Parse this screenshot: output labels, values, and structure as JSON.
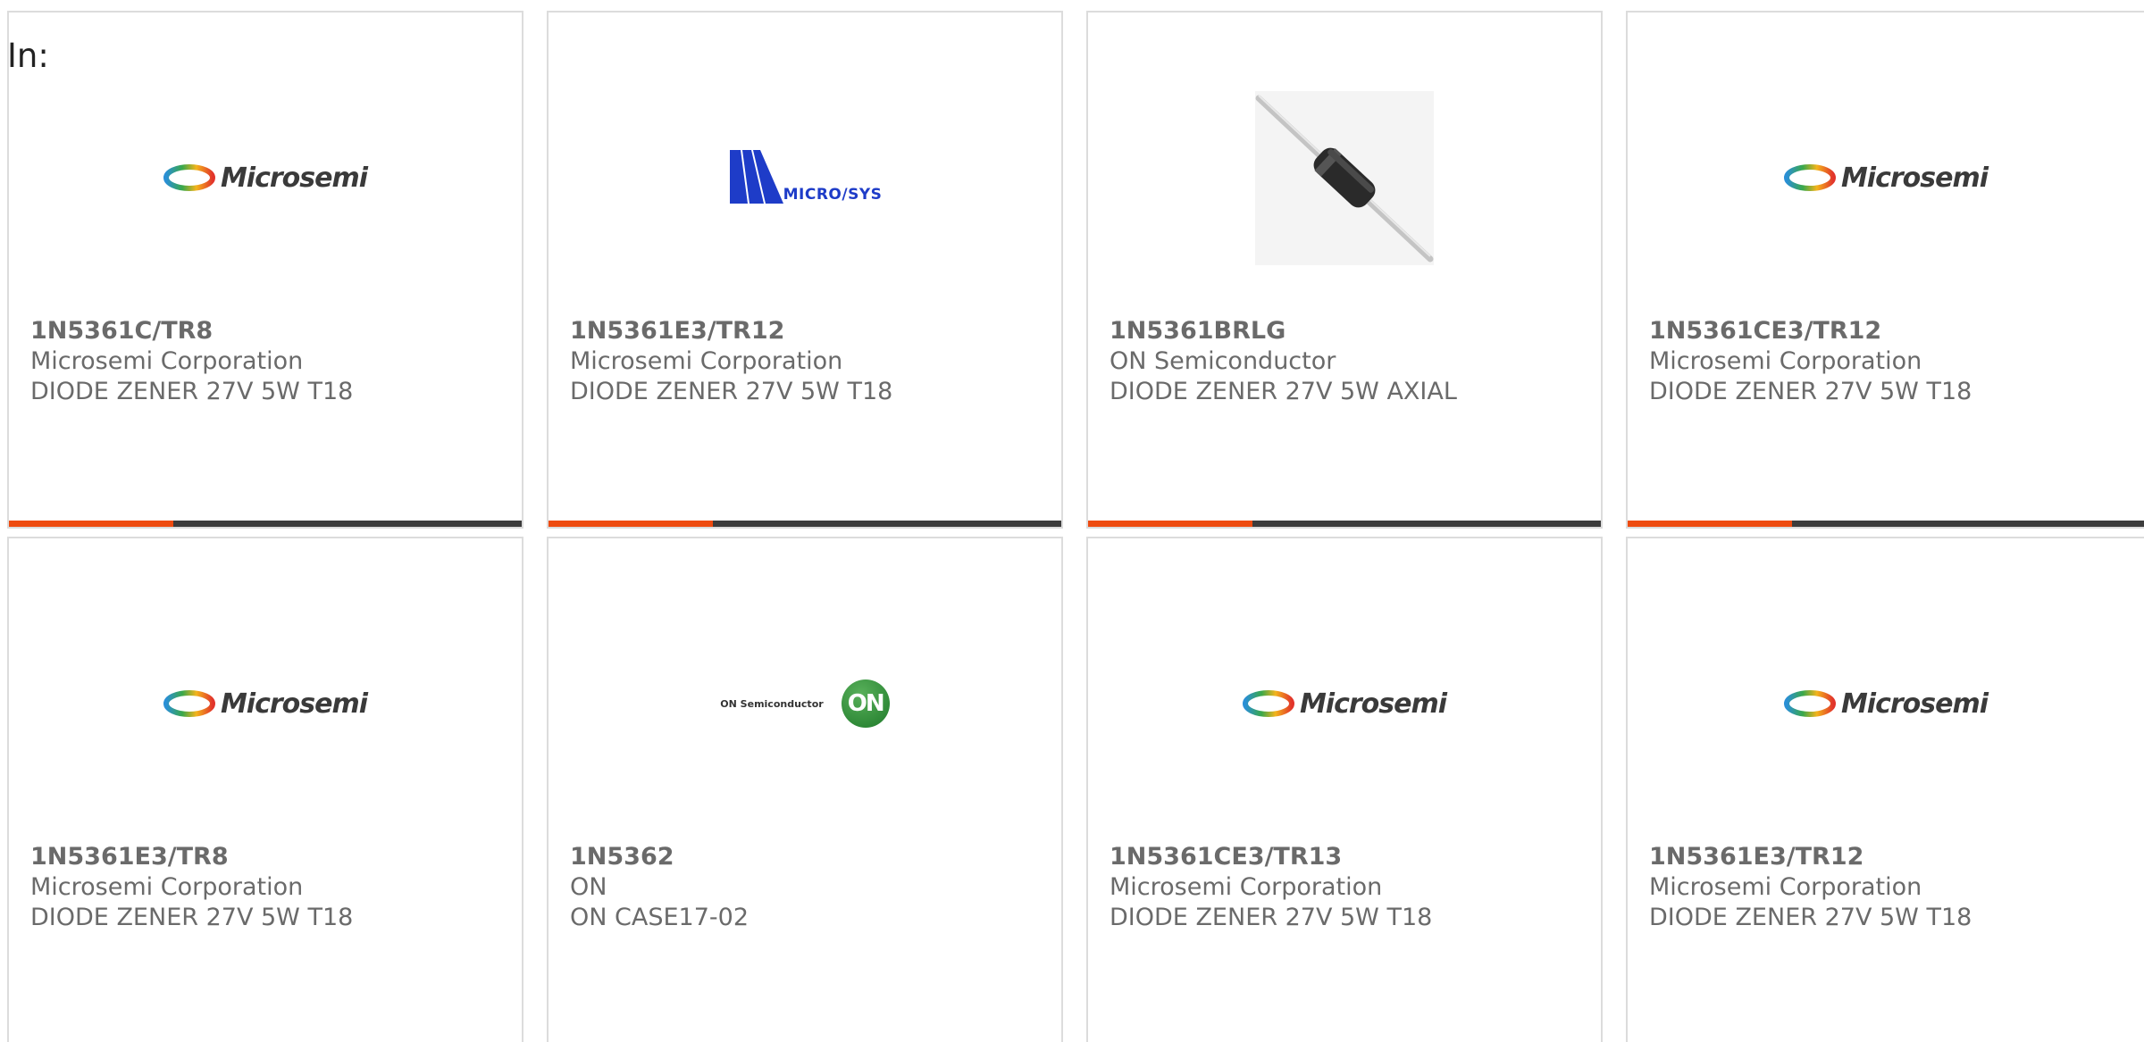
{
  "filter_label": "In:",
  "colors": {
    "accent": "#ee4b10",
    "bar": "#3c3c3c",
    "text": "#6a6a6a",
    "border": "#dcdcdc"
  },
  "logos": {
    "microsemi": "Microsemi",
    "microsys": "MICRO/SYS",
    "on_semi": "ON Semiconductor",
    "on_badge": "ON"
  },
  "products": [
    {
      "part": "1N5361C/TR8",
      "manufacturer": "Microsemi Corporation",
      "description": "DIODE ZENER 27V 5W T18",
      "image": "microsemi-logo"
    },
    {
      "part": "1N5361E3/TR12",
      "manufacturer": "Microsemi Corporation",
      "description": "DIODE ZENER 27V 5W T18",
      "image": "microsys-logo"
    },
    {
      "part": "1N5361BRLG",
      "manufacturer": "ON Semiconductor",
      "description": "DIODE ZENER 27V 5W AXIAL",
      "image": "diode-photo"
    },
    {
      "part": "1N5361CE3/TR12",
      "manufacturer": "Microsemi Corporation",
      "description": "DIODE ZENER 27V 5W T18",
      "image": "microsemi-logo"
    },
    {
      "part": "1N5361E3/TR8",
      "manufacturer": "Microsemi Corporation",
      "description": "DIODE ZENER 27V 5W T18",
      "image": "microsemi-logo"
    },
    {
      "part": "1N5362",
      "manufacturer": "ON",
      "description": "ON CASE17-02",
      "image": "on-semiconductor-logo"
    },
    {
      "part": "1N5361CE3/TR13",
      "manufacturer": "Microsemi Corporation",
      "description": "DIODE ZENER 27V 5W T18",
      "image": "microsemi-logo"
    },
    {
      "part": "1N5361E3/TR12",
      "manufacturer": "Microsemi Corporation",
      "description": "DIODE ZENER 27V 5W T18",
      "image": "microsemi-logo"
    }
  ]
}
